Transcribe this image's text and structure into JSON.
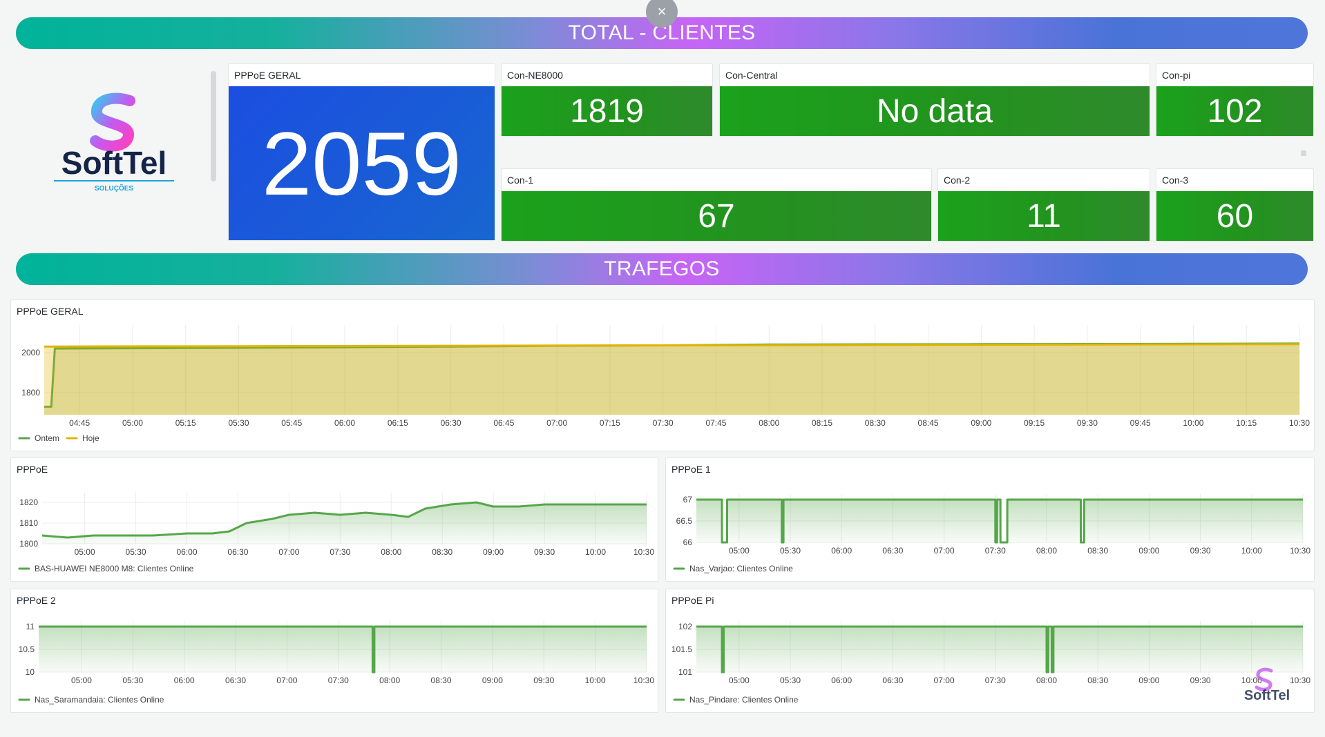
{
  "banners": {
    "total": "TOTAL - CLIENTES",
    "trafegos": "TRAFEGOS",
    "close": "×"
  },
  "logo": {
    "name": "SoftTel",
    "tagline": "SOLUÇÕES"
  },
  "stats": {
    "pppoe_geral": {
      "title": "PPPoE GERAL",
      "value": "2059"
    },
    "con_ne8000": {
      "title": "Con-NE8000",
      "value": "1819"
    },
    "con_central": {
      "title": "Con-Central",
      "value": "No data"
    },
    "con_pi": {
      "title": "Con-pi",
      "value": "102"
    },
    "con_1": {
      "title": "Con-1",
      "value": "67"
    },
    "con_2": {
      "title": "Con-2",
      "value": "11"
    },
    "con_3": {
      "title": "Con-3",
      "value": "60"
    }
  },
  "colors": {
    "green_series": "#56a64b",
    "yellow_series": "#e0b400",
    "stat_green": "#1ba21c",
    "stat_blue": "#1b4ee0"
  },
  "panels": {
    "geral": {
      "title": "PPPoE GERAL"
    },
    "pppoe": {
      "title": "PPPoE"
    },
    "pppoe1": {
      "title": "PPPoE 1"
    },
    "pppoe2": {
      "title": "PPPoE 2"
    },
    "pppoepi": {
      "title": "PPPoE Pi"
    }
  },
  "chart_data": [
    {
      "id": "geral",
      "type": "area",
      "title": "PPPoE GERAL",
      "x_ticks": [
        "04:45",
        "05:00",
        "05:15",
        "05:30",
        "05:45",
        "06:00",
        "06:15",
        "06:30",
        "06:45",
        "07:00",
        "07:15",
        "07:30",
        "07:45",
        "08:00",
        "08:15",
        "08:30",
        "08:45",
        "09:00",
        "09:15",
        "09:30",
        "09:45",
        "10:00",
        "10:15",
        "10:30"
      ],
      "x_range": [
        "04:35",
        "10:30"
      ],
      "y_ticks": [
        1800,
        2000
      ],
      "ylim": [
        1690,
        2110
      ],
      "series": [
        {
          "name": "Ontem",
          "color": "#56a64b",
          "points": [
            [
              "04:35",
              1730
            ],
            [
              "04:37",
              1730
            ],
            [
              "04:38",
              2020
            ],
            [
              "05:00",
              2022
            ],
            [
              "05:30",
              2024
            ],
            [
              "06:00",
              2027
            ],
            [
              "06:30",
              2030
            ],
            [
              "07:00",
              2034
            ],
            [
              "07:30",
              2036
            ],
            [
              "08:00",
              2040
            ],
            [
              "08:30",
              2041
            ],
            [
              "09:00",
              2042
            ],
            [
              "09:30",
              2043
            ],
            [
              "10:00",
              2044
            ],
            [
              "10:30",
              2045
            ]
          ]
        },
        {
          "name": "Hoje",
          "color": "#e0b400",
          "points": [
            [
              "04:35",
              2030
            ],
            [
              "05:00",
              2031
            ],
            [
              "05:30",
              2032
            ],
            [
              "06:00",
              2033
            ],
            [
              "06:30",
              2034
            ],
            [
              "07:00",
              2035
            ],
            [
              "07:30",
              2036
            ],
            [
              "08:00",
              2037
            ],
            [
              "08:30",
              2038
            ],
            [
              "09:00",
              2039
            ],
            [
              "09:30",
              2040
            ],
            [
              "10:00",
              2041
            ],
            [
              "10:30",
              2042
            ]
          ]
        }
      ]
    },
    {
      "id": "pppoe",
      "type": "area",
      "title": "PPPoE",
      "x_ticks": [
        "05:00",
        "05:30",
        "06:00",
        "06:30",
        "07:00",
        "07:30",
        "08:00",
        "08:30",
        "09:00",
        "09:30",
        "10:00",
        "10:30"
      ],
      "x_range": [
        "04:35",
        "10:30"
      ],
      "y_ticks": [
        1800,
        1810,
        1820
      ],
      "ylim": [
        1800,
        1822
      ],
      "series": [
        {
          "name": "BAS-HUAWEI NE8000 M8: Clientes Online",
          "color": "#56a64b",
          "points": [
            [
              "04:35",
              1804
            ],
            [
              "04:50",
              1803
            ],
            [
              "05:05",
              1804
            ],
            [
              "05:20",
              1804
            ],
            [
              "05:40",
              1804
            ],
            [
              "06:00",
              1805
            ],
            [
              "06:15",
              1805
            ],
            [
              "06:25",
              1806
            ],
            [
              "06:35",
              1810
            ],
            [
              "06:50",
              1812
            ],
            [
              "07:00",
              1814
            ],
            [
              "07:15",
              1815
            ],
            [
              "07:30",
              1814
            ],
            [
              "07:45",
              1815
            ],
            [
              "08:00",
              1814
            ],
            [
              "08:10",
              1813
            ],
            [
              "08:20",
              1817
            ],
            [
              "08:35",
              1819
            ],
            [
              "08:50",
              1820
            ],
            [
              "09:00",
              1818
            ],
            [
              "09:15",
              1818
            ],
            [
              "09:30",
              1819
            ],
            [
              "09:45",
              1819
            ],
            [
              "10:00",
              1819
            ],
            [
              "10:15",
              1819
            ],
            [
              "10:30",
              1819
            ]
          ]
        }
      ]
    },
    {
      "id": "pppoe1",
      "type": "area",
      "title": "PPPoE 1",
      "x_ticks": [
        "05:00",
        "05:30",
        "06:00",
        "06:30",
        "07:00",
        "07:30",
        "08:00",
        "08:30",
        "09:00",
        "09:30",
        "10:00",
        "10:30"
      ],
      "x_range": [
        "04:35",
        "10:30"
      ],
      "y_ticks": [
        66,
        66.5,
        67
      ],
      "ylim": [
        66,
        67
      ],
      "series": [
        {
          "name": "Nas_Varjao: Clientes Online",
          "color": "#56a64b",
          "points": [
            [
              "04:35",
              67
            ],
            [
              "04:50",
              67
            ],
            [
              "04:50",
              66
            ],
            [
              "04:53",
              66
            ],
            [
              "04:53",
              67
            ],
            [
              "05:25",
              67
            ],
            [
              "05:25",
              66
            ],
            [
              "05:26",
              66
            ],
            [
              "05:26",
              67
            ],
            [
              "07:30",
              67
            ],
            [
              "07:30",
              66
            ],
            [
              "07:31",
              66
            ],
            [
              "07:31",
              67
            ],
            [
              "07:33",
              67
            ],
            [
              "07:33",
              66
            ],
            [
              "07:37",
              66
            ],
            [
              "07:37",
              67
            ],
            [
              "08:20",
              67
            ],
            [
              "08:20",
              66
            ],
            [
              "08:22",
              66
            ],
            [
              "08:22",
              67
            ],
            [
              "10:30",
              67
            ]
          ]
        }
      ]
    },
    {
      "id": "pppoe2",
      "type": "area",
      "title": "PPPoE 2",
      "x_ticks": [
        "05:00",
        "05:30",
        "06:00",
        "06:30",
        "07:00",
        "07:30",
        "08:00",
        "08:30",
        "09:00",
        "09:30",
        "10:00",
        "10:30"
      ],
      "x_range": [
        "04:35",
        "10:30"
      ],
      "y_ticks": [
        10,
        10.5,
        11
      ],
      "ylim": [
        10,
        11
      ],
      "series": [
        {
          "name": "Nas_Saramandaia: Clientes Online",
          "color": "#56a64b",
          "points": [
            [
              "04:35",
              11
            ],
            [
              "07:50",
              11
            ],
            [
              "07:50",
              10
            ],
            [
              "07:51",
              10
            ],
            [
              "07:51",
              11
            ],
            [
              "10:30",
              11
            ]
          ]
        }
      ]
    },
    {
      "id": "pppoepi",
      "type": "area",
      "title": "PPPoE Pi",
      "x_ticks": [
        "05:00",
        "05:30",
        "06:00",
        "06:30",
        "07:00",
        "07:30",
        "08:00",
        "08:30",
        "09:00",
        "09:30",
        "10:00",
        "10:30"
      ],
      "x_range": [
        "04:35",
        "10:30"
      ],
      "y_ticks": [
        101,
        101.5,
        102
      ],
      "ylim": [
        101,
        102
      ],
      "series": [
        {
          "name": "Nas_Pindare: Clientes Online",
          "color": "#56a64b",
          "points": [
            [
              "04:35",
              102
            ],
            [
              "04:50",
              102
            ],
            [
              "04:50",
              101
            ],
            [
              "04:51",
              101
            ],
            [
              "04:51",
              102
            ],
            [
              "08:00",
              102
            ],
            [
              "08:00",
              101
            ],
            [
              "08:01",
              101
            ],
            [
              "08:01",
              102
            ],
            [
              "08:03",
              102
            ],
            [
              "08:03",
              101
            ],
            [
              "08:04",
              101
            ],
            [
              "08:04",
              102
            ],
            [
              "10:30",
              102
            ]
          ]
        }
      ]
    }
  ]
}
